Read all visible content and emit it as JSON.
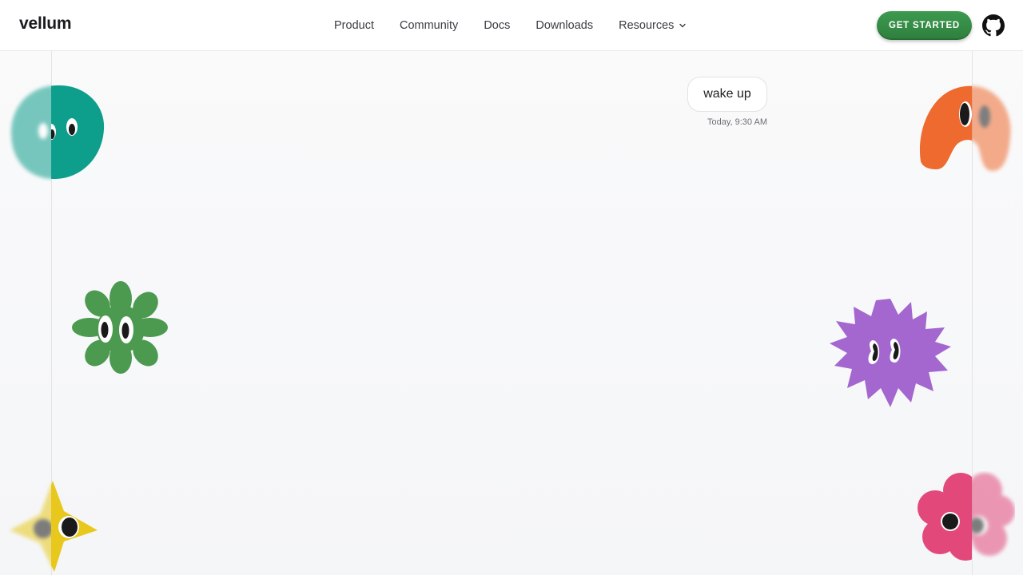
{
  "header": {
    "logo": "vellum",
    "nav": [
      {
        "label": "Product"
      },
      {
        "label": "Community"
      },
      {
        "label": "Docs"
      },
      {
        "label": "Downloads"
      },
      {
        "label": "Resources"
      }
    ],
    "cta_label": "GET STARTED"
  },
  "chat": {
    "message": "wake up",
    "timestamp": "Today, 9:30 AM"
  },
  "icons": {
    "github": "github-icon",
    "dropdown": "chevron-down-icon"
  },
  "colors": {
    "brand_green": "#2e7f3d",
    "teal": "#0e9e8c",
    "orange": "#ee6a2e",
    "green_flower": "#4c9a4f",
    "purple": "#a466cf",
    "yellow": "#e8c81c",
    "pink": "#e2497a"
  }
}
